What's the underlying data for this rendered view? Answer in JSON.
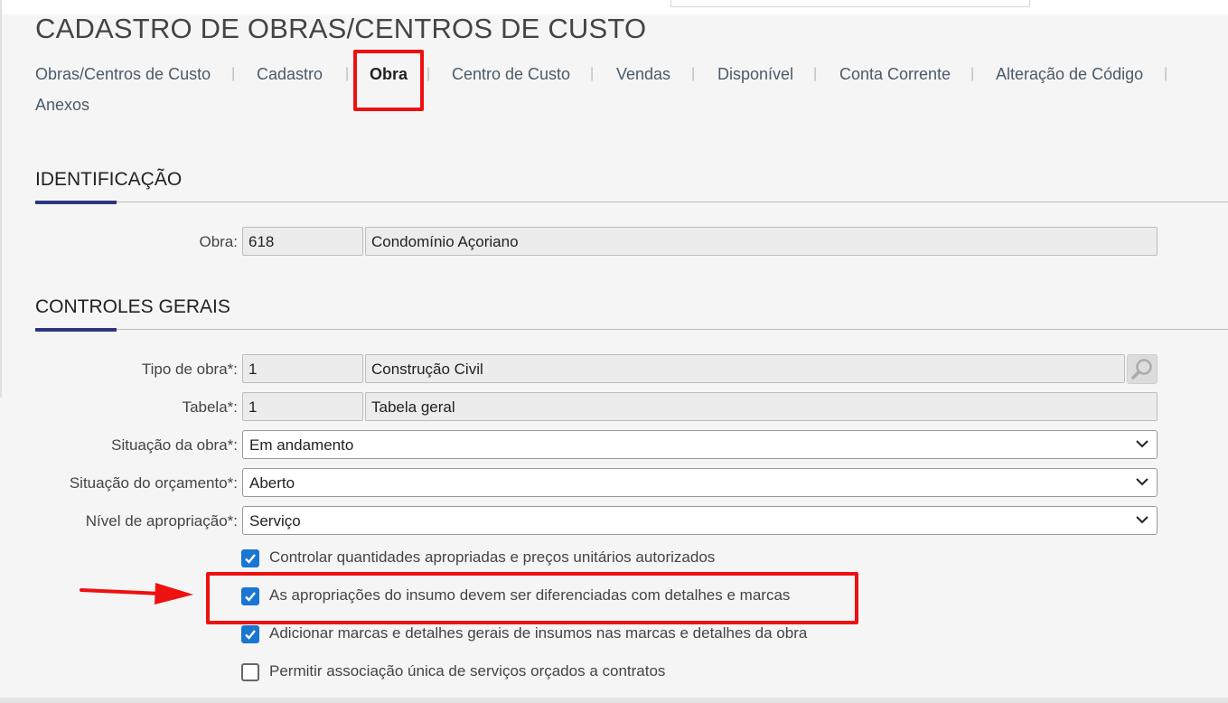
{
  "page": {
    "title": "CADASTRO DE OBRAS/CENTROS DE CUSTO"
  },
  "tabs": [
    {
      "label": "Obras/Centros de Custo"
    },
    {
      "label": "Cadastro"
    },
    {
      "label": "Obra",
      "active": true
    },
    {
      "label": "Centro de Custo"
    },
    {
      "label": "Vendas"
    },
    {
      "label": "Disponível"
    },
    {
      "label": "Conta Corrente"
    },
    {
      "label": "Alteração de Código"
    },
    {
      "label": "Anexos"
    }
  ],
  "identificacao": {
    "title": "IDENTIFICAÇÃO",
    "obra": {
      "label": "Obra:",
      "code": "618",
      "name": "Condomínio Açoriano"
    }
  },
  "controles": {
    "title": "CONTROLES GERAIS",
    "tipo_obra": {
      "label": "Tipo de obra*:",
      "code": "1",
      "name": "Construção Civil",
      "search_icon": "magnifier-icon"
    },
    "tabela": {
      "label": "Tabela*:",
      "code": "1",
      "name": "Tabela geral"
    },
    "situacao_obra": {
      "label": "Situação da obra*:",
      "value": "Em andamento"
    },
    "situacao_orcamento": {
      "label": "Situação do orçamento*:",
      "value": "Aberto"
    },
    "nivel_apropriacao": {
      "label": "Nível de apropriação*:",
      "value": "Serviço"
    },
    "checkboxes": [
      {
        "label": "Controlar quantidades apropriadas e preços unitários autorizados",
        "checked": true
      },
      {
        "label": "As apropriações do insumo devem ser diferenciadas com detalhes e marcas",
        "checked": true
      },
      {
        "label": "Adicionar marcas e detalhes gerais de insumos nas marcas e detalhes da obra",
        "checked": true
      },
      {
        "label": "Permitir associação única de serviços orçados a contratos",
        "checked": false
      }
    ]
  },
  "colors": {
    "accent": "#2e3580",
    "checkbox": "#1976d2",
    "annotation": "#ee1111"
  }
}
